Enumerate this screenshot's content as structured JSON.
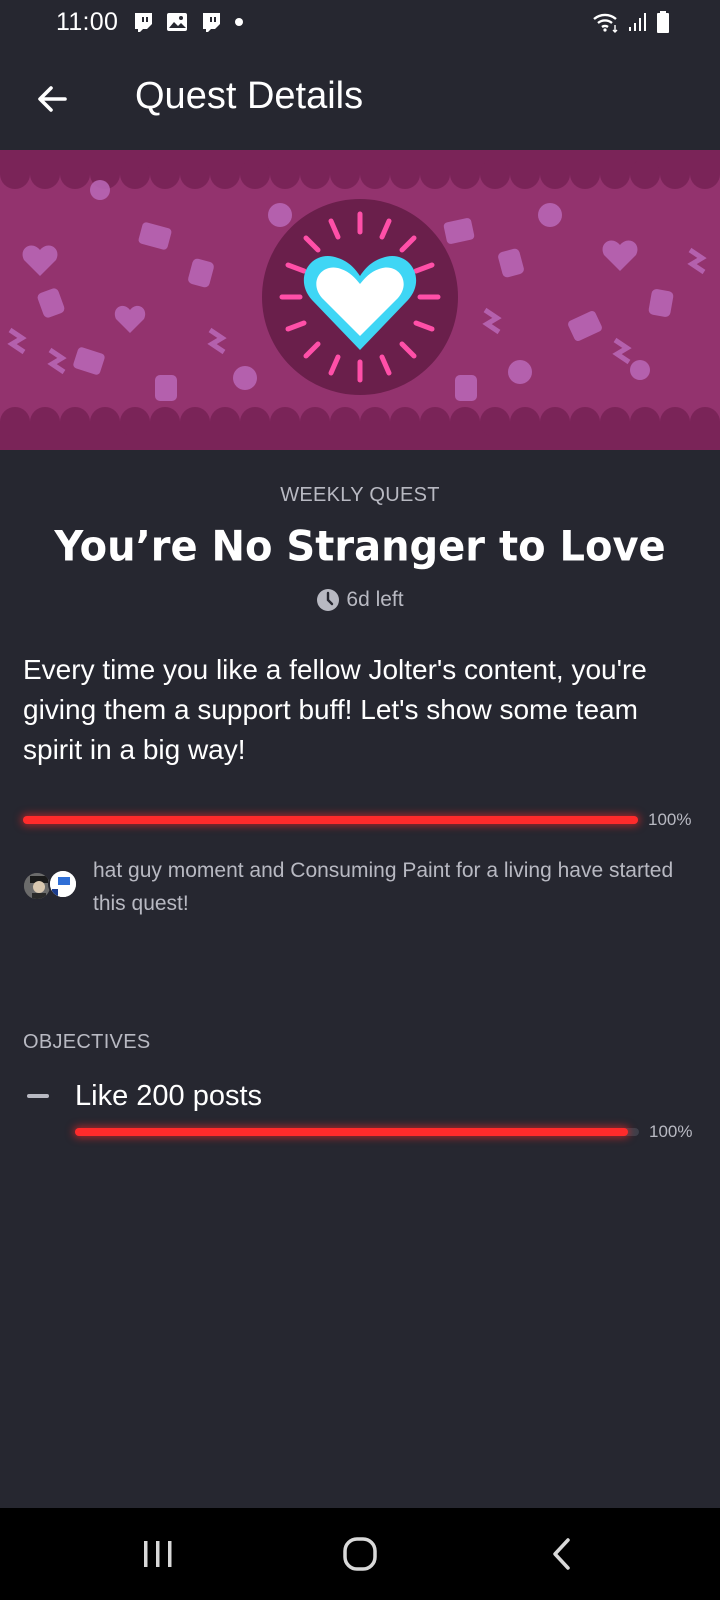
{
  "status_bar": {
    "time": "11:00",
    "left_icons": [
      "twitch-icon",
      "image-icon",
      "twitch-icon",
      "dot-icon"
    ],
    "right_icons": [
      "wifi-icon",
      "signal-icon",
      "battery-icon"
    ]
  },
  "app_bar": {
    "back_icon": "arrow-left-icon",
    "title": "Quest Details"
  },
  "banner": {
    "icon": "glowing-heart-icon",
    "colors": {
      "background": "#93336e",
      "scallop": "#7a2458",
      "circle": "#6a1f4b",
      "heart": "#3fd6f5",
      "rays": "#ff4fa8"
    }
  },
  "quest": {
    "category": "WEEKLY QUEST",
    "title": "You’re No Stranger to Love",
    "time_left": "6d left",
    "description": "Every time you like a fellow Jolter's content, you're giving them a support buff! Let's show some team spirit in a big way!",
    "progress_fraction": 1.0,
    "progress_label": "100%"
  },
  "participants": {
    "text": "hat guy moment and Consuming Paint for a living have started this quest!"
  },
  "objectives": {
    "heading": "OBJECTIVES",
    "items": [
      {
        "label": "Like 200 posts",
        "progress_fraction": 0.98,
        "progress_label": "100%"
      }
    ]
  },
  "colors": {
    "background": "#262730",
    "accent": "#ff2b2b",
    "muted_text": "#b8b9c2"
  },
  "nav_bar": {
    "buttons": [
      "recent-apps-icon",
      "home-icon",
      "back-chevron-icon"
    ]
  }
}
